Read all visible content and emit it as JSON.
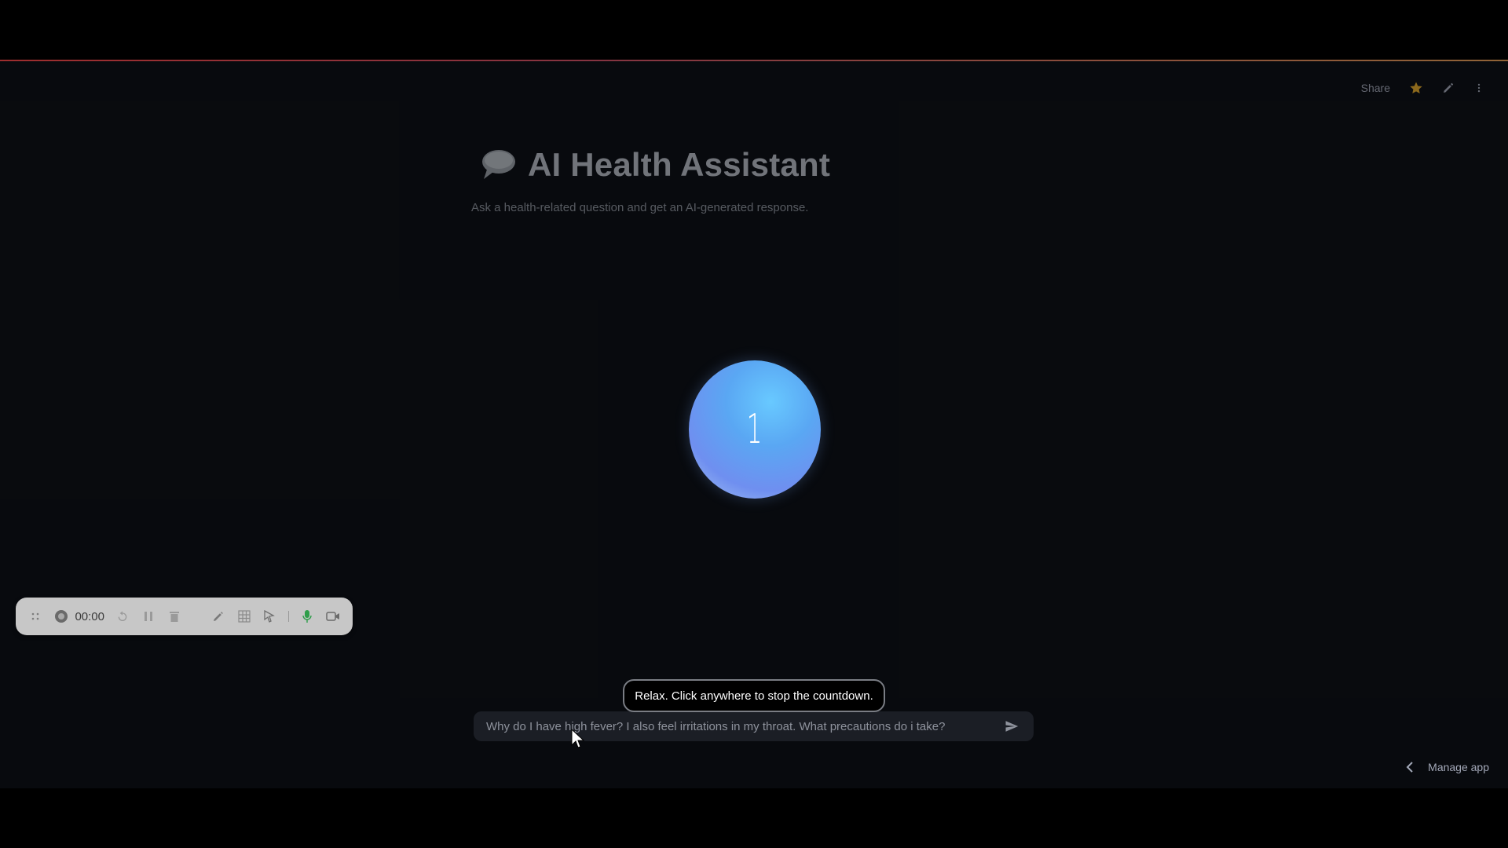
{
  "header": {
    "share_label": "Share",
    "icons": [
      "star-icon",
      "edit-pencil-icon",
      "more-vert-icon"
    ],
    "star_color": "#e0a82e"
  },
  "main": {
    "title_icon": "speech-bubble-icon",
    "title": "AI Health Assistant",
    "subtitle": "Ask a health-related question and get an AI-generated response."
  },
  "countdown": {
    "number": "1"
  },
  "recorder": {
    "time": "00:00",
    "icons": [
      "drag-handle-icon",
      "record-icon",
      "restart-icon",
      "pause-icon",
      "trash-icon",
      "pen-icon",
      "grid-icon",
      "pointer-icon",
      "microphone-icon",
      "camera-icon"
    ],
    "mic_color": "#2f9e4a"
  },
  "chat": {
    "input_value": "Why do I have high fever? I also feel irritations in my throat. What precautions do i take?",
    "send_icon": "send-icon"
  },
  "tooltip": {
    "text": "Relax. Click anywhere to stop the countdown."
  },
  "footer": {
    "manage_app_label": "Manage app",
    "icon": "chevron-left-icon"
  }
}
